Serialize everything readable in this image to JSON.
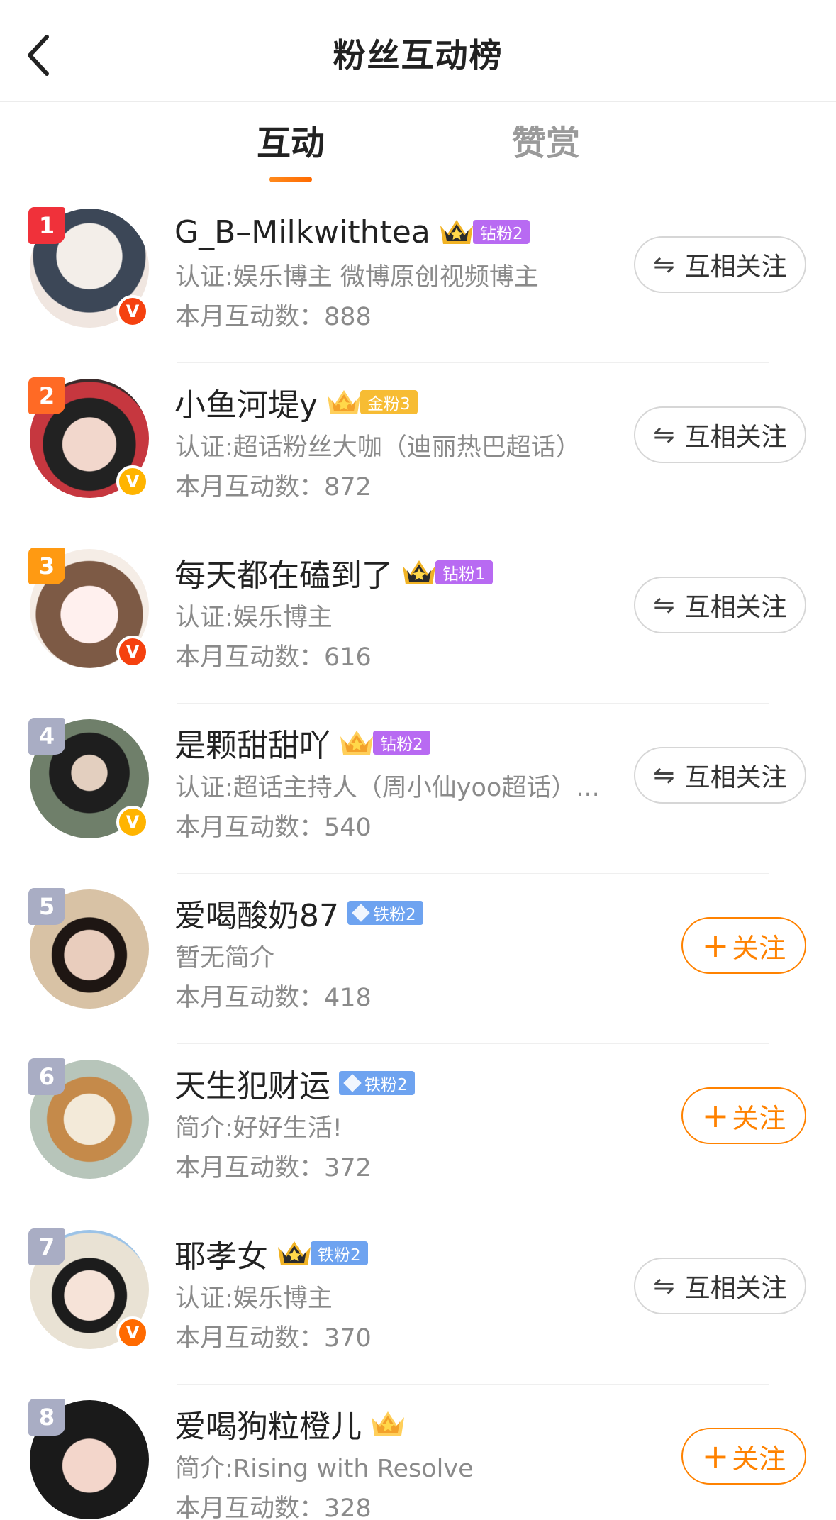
{
  "header": {
    "title": "粉丝互动榜",
    "back_icon": "chevron-left-icon"
  },
  "tabs": [
    {
      "label": "互动",
      "active": true
    },
    {
      "label": "赞赏",
      "active": false
    }
  ],
  "colors": {
    "accent": "#ff8200",
    "text_primary": "#222222",
    "text_secondary": "#8a8a8a"
  },
  "fans": [
    {
      "rank": "1",
      "name": "G_B–Milkwithtea",
      "tag": "钻粉2",
      "tag_color": "purple",
      "crown": "star-crown-icon",
      "verify": "red",
      "desc": "认证:娱乐博主 微博原创视频博主",
      "count_label": "本月互动数：888",
      "action": "mutual",
      "action_label": "互相关注"
    },
    {
      "rank": "2",
      "name": "小鱼河堤y",
      "tag": "金粉3",
      "tag_color": "gold",
      "crown": "gold-crown-icon",
      "verify": "gold",
      "desc": "认证:超话粉丝大咖（迪丽热巴超话）",
      "count_label": "本月互动数：872",
      "action": "mutual",
      "action_label": "互相关注"
    },
    {
      "rank": "3",
      "name": "每天都在磕到了",
      "tag": "钻粉1",
      "tag_color": "purple",
      "crown": "star-crown-icon",
      "verify": "red",
      "desc": "认证:娱乐博主",
      "count_label": "本月互动数：616",
      "action": "mutual",
      "action_label": "互相关注"
    },
    {
      "rank": "4",
      "name": "是颗甜甜吖",
      "tag": "钻粉2",
      "tag_color": "purple",
      "crown": "gold-crown-icon",
      "verify": "gold",
      "desc": "认证:超话主持人（周小仙yoo超话）...",
      "count_label": "本月互动数：540",
      "action": "mutual",
      "action_label": "互相关注"
    },
    {
      "rank": "5",
      "name": "爱喝酸奶87",
      "tag": "铁粉2",
      "tag_color": "blue",
      "crown": "",
      "verify": "",
      "desc": "暂无简介",
      "count_label": "本月互动数：418",
      "action": "follow",
      "action_label": "关注"
    },
    {
      "rank": "6",
      "name": "天生犯财运",
      "tag": "铁粉2",
      "tag_color": "blue",
      "crown": "",
      "verify": "",
      "desc": "简介:好好生活!",
      "count_label": "本月互动数：372",
      "action": "follow",
      "action_label": "关注"
    },
    {
      "rank": "7",
      "name": "耶孝女",
      "tag": "铁粉2",
      "tag_color": "blue",
      "crown": "star-crown-icon",
      "verify": "orange",
      "desc": "认证:娱乐博主",
      "count_label": "本月互动数：370",
      "action": "mutual",
      "action_label": "互相关注"
    },
    {
      "rank": "8",
      "name": "爱喝狗粒橙儿",
      "tag": "",
      "tag_color": "",
      "crown": "gold-crown-icon",
      "verify": "",
      "desc": "简介:Rising with Resolve",
      "count_label": "本月互动数：328",
      "action": "follow",
      "action_label": "关注"
    }
  ]
}
